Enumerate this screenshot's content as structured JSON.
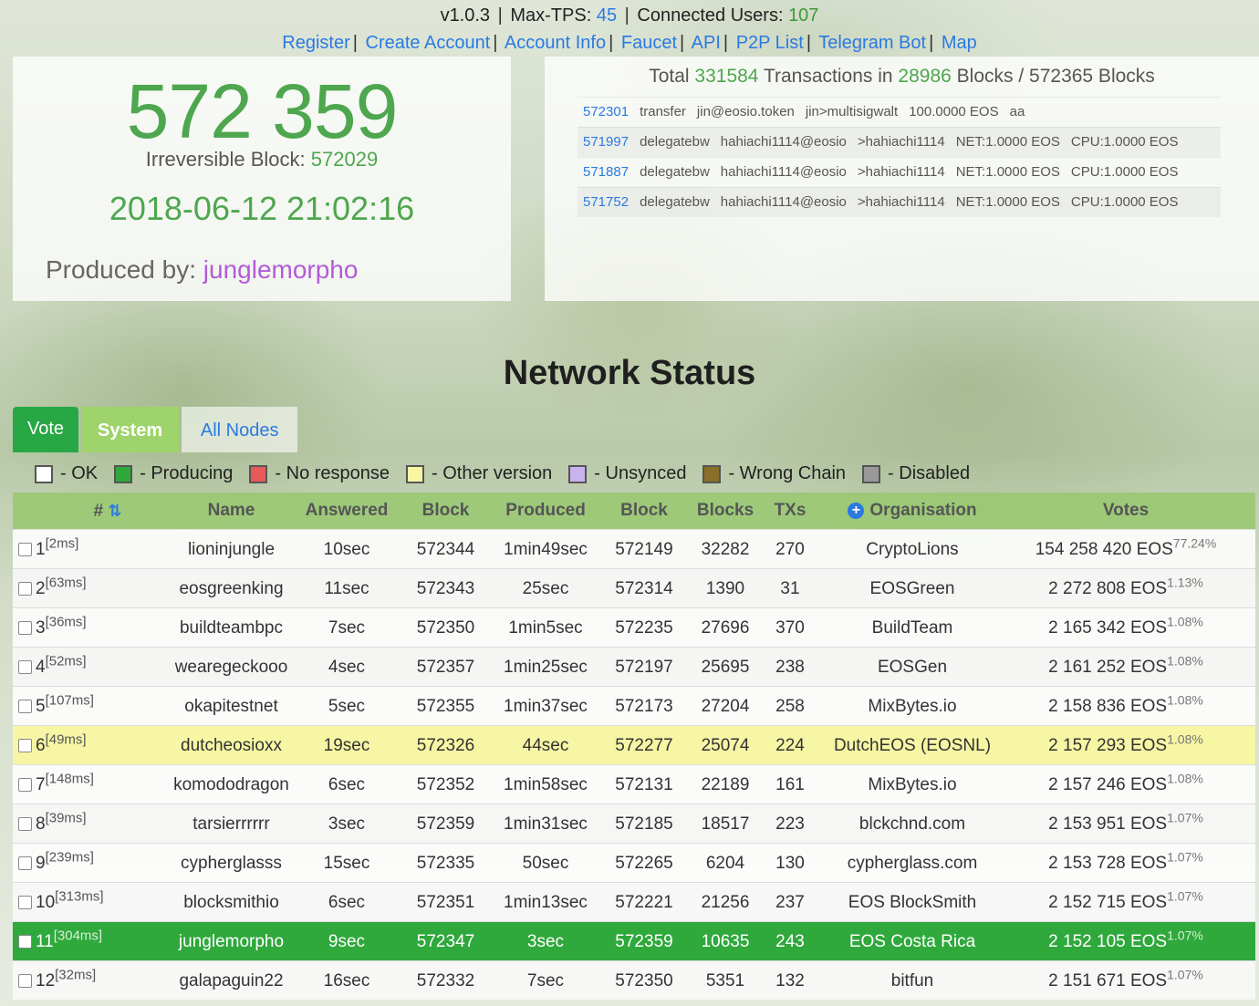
{
  "header": {
    "version": "v1.0.3",
    "max_tps_label": "Max-TPS:",
    "max_tps_value": "45",
    "users_label": "Connected Users:",
    "users_value": "107",
    "nav": [
      "Register",
      "Create Account",
      "Account Info",
      "Faucet",
      "API",
      "P2P List",
      "Telegram Bot",
      "Map"
    ]
  },
  "block_panel": {
    "head_block": "572 359",
    "irreversible_label": "Irreversible Block:",
    "irreversible_value": "572029",
    "timestamp": "2018-06-12 21:02:16",
    "produced_by_label": "Produced by:",
    "producer": "junglemorpho"
  },
  "tx_panel": {
    "total_prefix": "Total",
    "total_tx": "331584",
    "mid_text": "Transactions in",
    "blocks_with_tx": "28986",
    "blocks_suffix": "Blocks / 572365 Blocks",
    "transactions": [
      {
        "id": "572301",
        "action": "transfer",
        "actor": "jin@eosio.token",
        "target": "jin>multisigwalt",
        "amount": "100.0000 EOS",
        "extra": "aa"
      },
      {
        "id": "571997",
        "action": "delegatebw",
        "actor": "hahiachi1114@eosio",
        "target": ">hahiachi1114",
        "amount": "NET:1.0000 EOS",
        "extra": "CPU:1.0000 EOS"
      },
      {
        "id": "571887",
        "action": "delegatebw",
        "actor": "hahiachi1114@eosio",
        "target": ">hahiachi1114",
        "amount": "NET:1.0000 EOS",
        "extra": "CPU:1.0000 EOS"
      },
      {
        "id": "571752",
        "action": "delegatebw",
        "actor": "hahiachi1114@eosio",
        "target": ">hahiachi1114",
        "amount": "NET:1.0000 EOS",
        "extra": "CPU:1.0000 EOS"
      }
    ]
  },
  "section_title": "Network Status",
  "tabs": [
    "Vote",
    "System",
    "All Nodes"
  ],
  "legend": [
    {
      "label": "- OK",
      "color": "#ffffff"
    },
    {
      "label": "- Producing",
      "color": "#2fa83c"
    },
    {
      "label": "- No response",
      "color": "#e65a5a"
    },
    {
      "label": "- Other version",
      "color": "#f6f6a4"
    },
    {
      "label": "- Unsynced",
      "color": "#c9b3ee"
    },
    {
      "label": "- Wrong Chain",
      "color": "#8a6f2a"
    },
    {
      "label": "- Disabled",
      "color": "#999999"
    }
  ],
  "table": {
    "columns": [
      "#",
      "Name",
      "Answered",
      "Block",
      "Produced",
      "Block",
      "Blocks",
      "TXs",
      "Organisation",
      "Votes"
    ],
    "rows": [
      {
        "rank": "1",
        "ms": "[2ms]",
        "name": "lioninjungle",
        "answered": "10sec",
        "block": "572344",
        "produced": "1min49sec",
        "block2": "572149",
        "blocks": "32282",
        "txs": "270",
        "org": "CryptoLions",
        "votes": "154 258 420 EOS",
        "pct": "77.24%",
        "status": "ok"
      },
      {
        "rank": "2",
        "ms": "[63ms]",
        "name": "eosgreenking",
        "answered": "11sec",
        "block": "572343",
        "produced": "25sec",
        "block2": "572314",
        "blocks": "1390",
        "txs": "31",
        "org": "EOSGreen",
        "votes": "2 272 808 EOS",
        "pct": "1.13%",
        "status": "ok"
      },
      {
        "rank": "3",
        "ms": "[36ms]",
        "name": "buildteambpc",
        "answered": "7sec",
        "block": "572350",
        "produced": "1min5sec",
        "block2": "572235",
        "blocks": "27696",
        "txs": "370",
        "org": "BuildTeam",
        "votes": "2 165 342 EOS",
        "pct": "1.08%",
        "status": "ok"
      },
      {
        "rank": "4",
        "ms": "[52ms]",
        "name": "wearegeckooo",
        "answered": "4sec",
        "block": "572357",
        "produced": "1min25sec",
        "block2": "572197",
        "blocks": "25695",
        "txs": "238",
        "org": "EOSGen",
        "votes": "2 161 252 EOS",
        "pct": "1.08%",
        "status": "ok"
      },
      {
        "rank": "5",
        "ms": "[107ms]",
        "name": "okapitestnet",
        "answered": "5sec",
        "block": "572355",
        "produced": "1min37sec",
        "block2": "572173",
        "blocks": "27204",
        "txs": "258",
        "org": "MixBytes.io",
        "votes": "2 158 836 EOS",
        "pct": "1.08%",
        "status": "ok"
      },
      {
        "rank": "6",
        "ms": "[49ms]",
        "name": "dutcheosioxx",
        "answered": "19sec",
        "block": "572326",
        "produced": "44sec",
        "block2": "572277",
        "blocks": "25074",
        "txs": "224",
        "org": "DutchEOS (EOSNL)",
        "votes": "2 157 293 EOS",
        "pct": "1.08%",
        "status": "other-version"
      },
      {
        "rank": "7",
        "ms": "[148ms]",
        "name": "komododragon",
        "answered": "6sec",
        "block": "572352",
        "produced": "1min58sec",
        "block2": "572131",
        "blocks": "22189",
        "txs": "161",
        "org": "MixBytes.io",
        "votes": "2 157 246 EOS",
        "pct": "1.08%",
        "status": "ok"
      },
      {
        "rank": "8",
        "ms": "[39ms]",
        "name": "tarsierrrrrr",
        "answered": "3sec",
        "block": "572359",
        "produced": "1min31sec",
        "block2": "572185",
        "blocks": "18517",
        "txs": "223",
        "org": "blckchnd.com",
        "votes": "2 153 951 EOS",
        "pct": "1.07%",
        "status": "ok"
      },
      {
        "rank": "9",
        "ms": "[239ms]",
        "name": "cypherglasss",
        "answered": "15sec",
        "block": "572335",
        "produced": "50sec",
        "block2": "572265",
        "blocks": "6204",
        "txs": "130",
        "org": "cypherglass.com",
        "votes": "2 153 728 EOS",
        "pct": "1.07%",
        "status": "ok"
      },
      {
        "rank": "10",
        "ms": "[313ms]",
        "name": "blocksmithio",
        "answered": "6sec",
        "block": "572351",
        "produced": "1min13sec",
        "block2": "572221",
        "blocks": "21256",
        "txs": "237",
        "org": "EOS BlockSmith",
        "votes": "2 152 715 EOS",
        "pct": "1.07%",
        "status": "ok"
      },
      {
        "rank": "11",
        "ms": "[304ms]",
        "name": "junglemorpho",
        "answered": "9sec",
        "block": "572347",
        "produced": "3sec",
        "block2": "572359",
        "blocks": "10635",
        "txs": "243",
        "org": "EOS Costa Rica",
        "votes": "2 152 105 EOS",
        "pct": "1.07%",
        "status": "producing"
      },
      {
        "rank": "12",
        "ms": "[32ms]",
        "name": "galapaguin22",
        "answered": "16sec",
        "block": "572332",
        "produced": "7sec",
        "block2": "572350",
        "blocks": "5351",
        "txs": "132",
        "org": "bitfun",
        "votes": "2 151 671 EOS",
        "pct": "1.07%",
        "status": "ok"
      }
    ]
  }
}
